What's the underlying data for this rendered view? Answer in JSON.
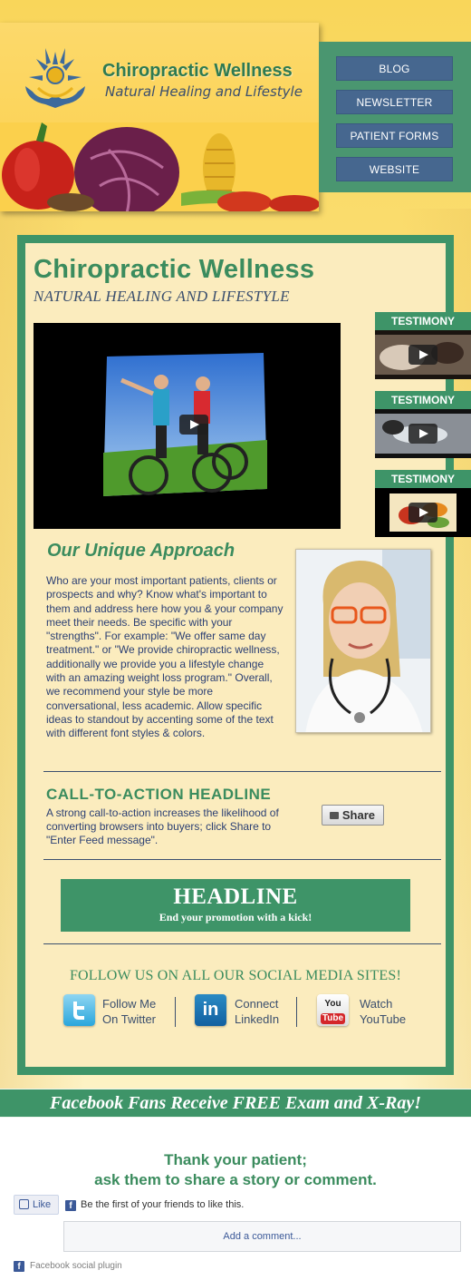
{
  "brand": {
    "title": "Chiropractic Wellness",
    "subtitle": "Natural Healing and Lifestyle"
  },
  "nav": {
    "items": [
      {
        "label": "BLOG"
      },
      {
        "label": "NEWSLETTER"
      },
      {
        "label": "PATIENT FORMS"
      },
      {
        "label": "WEBSITE"
      }
    ]
  },
  "main": {
    "title": "Chiropractic Wellness",
    "subtitle": "NATURAL HEALING AND LIFESTYLE"
  },
  "testimonials": [
    {
      "label": "TESTIMONY"
    },
    {
      "label": "TESTIMONY"
    },
    {
      "label": "TESTIMONY"
    }
  ],
  "approach": {
    "title": "Our Unique Approach",
    "body": "Who are your most important patients, clients or prospects and why? Know what's important to them and address here how you & your company meet their needs. Be specific with your \"strengths\". For example: \"We offer same day treatment.\" or \"We provide chiropractic wellness, additionally we provide you a lifestyle change with an amazing weight loss program.\" Overall, we recommend your style be more conversational, less academic. Allow specific ideas to standout by accenting some of the text with different font styles & colors."
  },
  "cta": {
    "title": "CALL-TO-ACTION HEADLINE",
    "body": "A strong call-to-action increases the likelihood of converting browsers into buyers; click Share to \"Enter Feed message\".",
    "share_label": "Share"
  },
  "promo": {
    "headline": "HEADLINE",
    "subline": "End your promotion with a kick!"
  },
  "social": {
    "title": "FOLLOW US ON ALL OUR SOCIAL MEDIA SITES!",
    "items": [
      {
        "line1": "Follow Me",
        "line2": "On Twitter",
        "icon": "twitter-icon"
      },
      {
        "line1": "Connect",
        "line2": "LinkedIn",
        "icon": "linkedin-icon",
        "icon_text": "in"
      },
      {
        "line1": "Watch",
        "line2": "YouTube",
        "icon": "youtube-icon",
        "icon_text_top": "You",
        "icon_text_bottom": "Tube"
      }
    ]
  },
  "fb_banner": "Facebook Fans Receive FREE Exam and X-Ray!",
  "thanks": {
    "line1": "Thank your patient;",
    "line2": "ask them to share a story or comment."
  },
  "facebook": {
    "like_label": "Like",
    "like_text": "Be the first of your friends to like this.",
    "comment_placeholder": "Add a comment...",
    "plugin_label": "Facebook social plugin",
    "fb_glyph": "f"
  },
  "colors": {
    "green": "#3e9468",
    "navy": "#3b4f6e",
    "nav_button": "#46678f",
    "cream": "#fbecbe",
    "yellow": "#f9d65a"
  }
}
